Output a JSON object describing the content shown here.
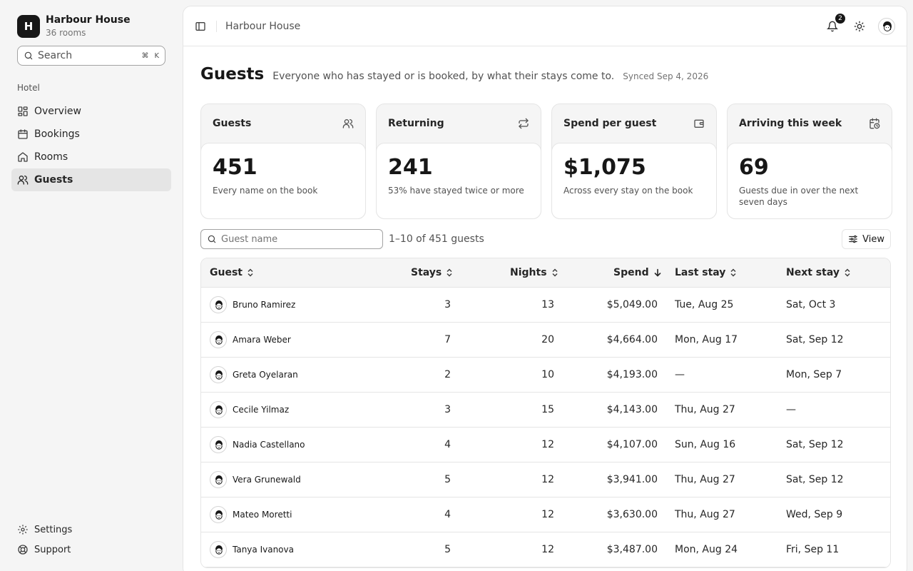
{
  "brand": {
    "initial": "H",
    "name": "Harbour House",
    "subtitle": "36 rooms"
  },
  "sidebar": {
    "search_label": "Search",
    "search_shortcut_mod": "⌘",
    "search_shortcut_key": "K",
    "section_label": "Hotel",
    "items": [
      {
        "label": "Overview",
        "icon": "grid-icon",
        "active": false
      },
      {
        "label": "Bookings",
        "icon": "calendar-icon",
        "active": false
      },
      {
        "label": "Rooms",
        "icon": "home-icon",
        "active": false
      },
      {
        "label": "Guests",
        "icon": "users-icon",
        "active": true
      }
    ],
    "bottom_items": [
      {
        "label": "Settings",
        "icon": "gear-icon"
      },
      {
        "label": "Support",
        "icon": "lifebuoy-icon"
      }
    ]
  },
  "topbar": {
    "breadcrumb": "Harbour House",
    "notification_count": "2"
  },
  "page": {
    "title": "Guests",
    "subtitle": "Everyone who has stayed or is booked, by what their stays come to.",
    "synced": "Synced Sep 4, 2026"
  },
  "cards": [
    {
      "label": "Guests",
      "icon": "users-icon",
      "value": "451",
      "note": "Every name on the book"
    },
    {
      "label": "Returning",
      "icon": "repeat-icon",
      "value": "241",
      "note": "53% have stayed twice or more"
    },
    {
      "label": "Spend per guest",
      "icon": "wallet-icon",
      "value": "$1,075",
      "note": "Across every stay on the book"
    },
    {
      "label": "Arriving this week",
      "icon": "calendar-clock-icon",
      "value": "69",
      "note": "Guests due in over the next seven days"
    }
  ],
  "filter": {
    "placeholder": "Guest name",
    "value": "",
    "count": "1–10 of 451 guests",
    "view_label": "View"
  },
  "table": {
    "columns": [
      {
        "label": "Guest",
        "sort": "none"
      },
      {
        "label": "Stays",
        "sort": "none"
      },
      {
        "label": "Nights",
        "sort": "none"
      },
      {
        "label": "Spend",
        "sort": "desc"
      },
      {
        "label": "Last stay",
        "sort": "none"
      },
      {
        "label": "Next stay",
        "sort": "none"
      }
    ],
    "rows": [
      {
        "guest": "Bruno Ramirez",
        "stays": "3",
        "nights": "13",
        "spend": "$5,049.00",
        "last": "Tue, Aug 25",
        "next": "Sat, Oct 3"
      },
      {
        "guest": "Amara Weber",
        "stays": "7",
        "nights": "20",
        "spend": "$4,664.00",
        "last": "Mon, Aug 17",
        "next": "Sat, Sep 12"
      },
      {
        "guest": "Greta Oyelaran",
        "stays": "2",
        "nights": "10",
        "spend": "$4,193.00",
        "last": "—",
        "next": "Mon, Sep 7"
      },
      {
        "guest": "Cecile Yilmaz",
        "stays": "3",
        "nights": "15",
        "spend": "$4,143.00",
        "last": "Thu, Aug 27",
        "next": "—"
      },
      {
        "guest": "Nadia Castellano",
        "stays": "4",
        "nights": "12",
        "spend": "$4,107.00",
        "last": "Sun, Aug 16",
        "next": "Sat, Sep 12"
      },
      {
        "guest": "Vera Grunewald",
        "stays": "5",
        "nights": "12",
        "spend": "$3,941.00",
        "last": "Thu, Aug 27",
        "next": "Sat, Sep 12"
      },
      {
        "guest": "Mateo Moretti",
        "stays": "4",
        "nights": "12",
        "spend": "$3,630.00",
        "last": "Thu, Aug 27",
        "next": "Wed, Sep 9"
      },
      {
        "guest": "Tanya Ivanova",
        "stays": "5",
        "nights": "12",
        "spend": "$3,487.00",
        "last": "Mon, Aug 24",
        "next": "Fri, Sep 11"
      }
    ]
  }
}
